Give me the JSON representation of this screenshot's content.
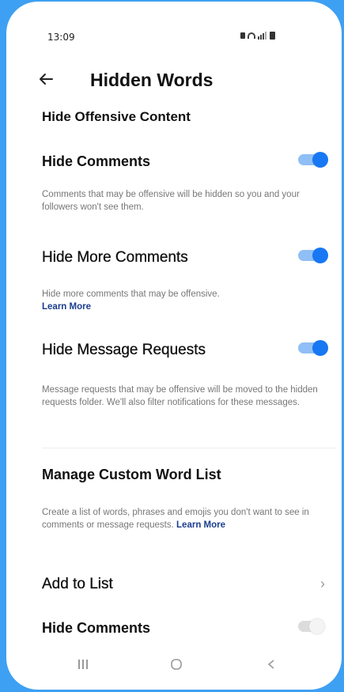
{
  "status_bar": {
    "time": "13:09"
  },
  "header": {
    "title": "Hidden Words",
    "back_icon": "arrow-left-icon"
  },
  "sections": {
    "offensive": {
      "title": "Hide Offensive Content",
      "hide_comments": {
        "label": "Hide Comments",
        "enabled": true,
        "description": "Comments that may be offensive will be hidden so you and your followers won't see them."
      },
      "hide_more_comments": {
        "label": "Hide More Comments",
        "enabled": true,
        "description": "Hide more comments that may be offensive.",
        "learn_more": "Learn More"
      },
      "hide_message_requests": {
        "label": "Hide Message Requests",
        "enabled": true,
        "description": "Message requests that may be offensive will be moved to the hidden requests folder. We'll also filter notifications for these messages."
      }
    },
    "custom": {
      "title": "Manage Custom Word List",
      "description": "Create a list of words, phrases and emojis you don't want to see in comments or message requests.",
      "learn_more": "Learn More",
      "add_to_list": "Add to List",
      "hide_comments": {
        "label": "Hide Comments",
        "enabled": false
      }
    }
  },
  "colors": {
    "accent": "#1877f2",
    "background": "#3ea0f2",
    "link": "#1b3d8c"
  },
  "nav_bar": {
    "recents_icon": "recents-icon",
    "home_icon": "home-icon",
    "back_icon": "back-chevron-icon"
  }
}
